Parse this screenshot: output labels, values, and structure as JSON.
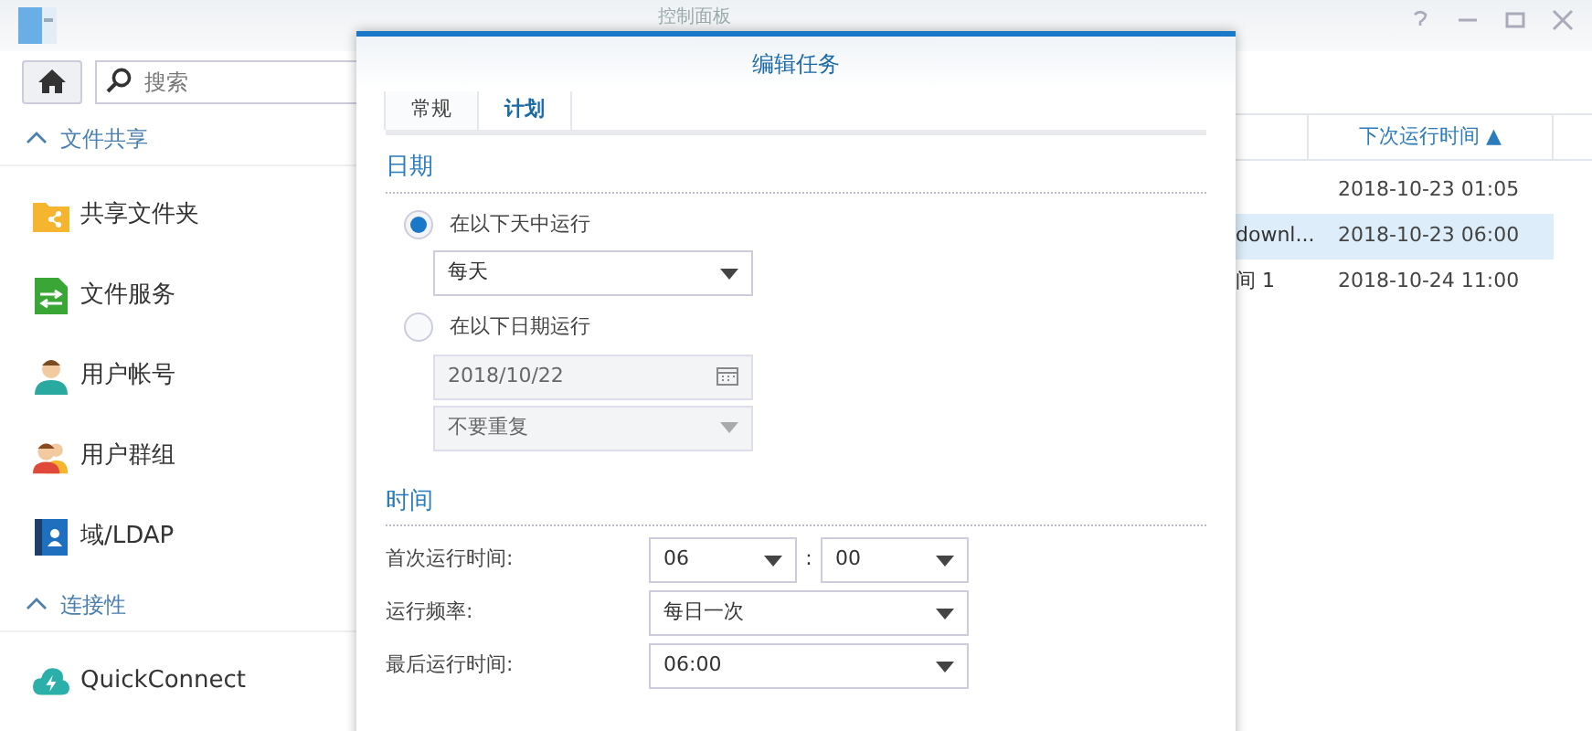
{
  "window": {
    "title": "控制面板"
  },
  "search": {
    "placeholder": "搜索"
  },
  "sidebar": [
    {
      "kind": "section",
      "label": "文件共享",
      "expanded": true
    },
    {
      "kind": "item",
      "label": "共享文件夹"
    },
    {
      "kind": "item",
      "label": "文件服务"
    },
    {
      "kind": "item",
      "label": "用户帐号"
    },
    {
      "kind": "item",
      "label": "用户群组"
    },
    {
      "kind": "item",
      "label": "域/LDAP"
    },
    {
      "kind": "section",
      "label": "连接性",
      "expanded": true
    },
    {
      "kind": "item",
      "label": "QuickConnect"
    }
  ],
  "table": {
    "columns": [
      "下次运行时间 ▲"
    ],
    "rows": [
      {
        "column_1": "",
        "next_run": "2018-10-23 01:05",
        "selected": false
      },
      {
        "column_1": "downl...",
        "next_run": "2018-10-23 06:00",
        "selected": true
      },
      {
        "column_1": "间 1",
        "next_run": "2018-10-24 11:00",
        "selected": false
      }
    ]
  },
  "dialog": {
    "title": "编辑任务",
    "tabs": [
      {
        "label": "常规",
        "selected": false
      },
      {
        "label": "计划",
        "selected": true
      }
    ],
    "date_section": {
      "heading": "日期",
      "options": [
        {
          "label": "在以下天中运行",
          "selected": true,
          "fields": [
            {
              "kind": "select",
              "value": "每天",
              "disabled": false
            }
          ]
        },
        {
          "label": "在以下日期运行",
          "selected": false,
          "fields": [
            {
              "kind": "date",
              "value": "2018/10/22",
              "disabled": true
            },
            {
              "kind": "select",
              "value": "不要重复",
              "disabled": true
            }
          ]
        }
      ]
    },
    "time_section": {
      "heading": "时间",
      "first_run_label": "首次运行时间:",
      "first_run_hour": "06",
      "separator": ":",
      "first_run_minute": "00",
      "frequency_label": "运行频率:",
      "frequency": "每日一次",
      "last_run_label": "最后运行时间:",
      "last_run": "06:00"
    }
  }
}
